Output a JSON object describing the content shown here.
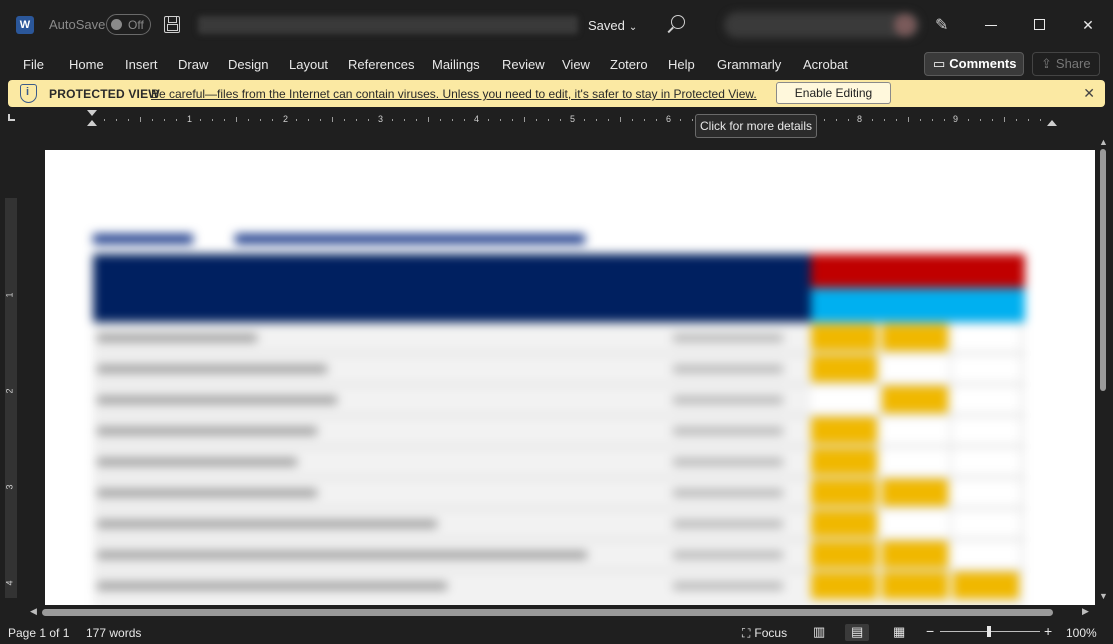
{
  "titlebar": {
    "app_icon": "word-icon",
    "app_letter": "W",
    "autosave_label": "AutoSave",
    "autosave_state": "Off",
    "saved_status": "Saved",
    "minimize": "minimize-icon",
    "maximize": "maximize-icon",
    "close": "✕"
  },
  "menu": {
    "items": [
      "File",
      "Home",
      "Insert",
      "Draw",
      "Design",
      "Layout",
      "References",
      "Mailings",
      "Review",
      "View",
      "Zotero",
      "Help",
      "Grammarly",
      "Acrobat"
    ],
    "comments_label": "Comments",
    "share_label": "Share"
  },
  "protected_view": {
    "title": "PROTECTED VIEW",
    "message": "Be careful—files from the Internet can contain viruses. Unless you need to edit, it's safer to stay in Protected View.",
    "button": "Enable Editing",
    "close": "✕"
  },
  "ruler": {
    "numbers": [
      "1",
      "2",
      "3",
      "4",
      "5",
      "6",
      "7",
      "8",
      "9"
    ],
    "vertical_numbers": [
      "1",
      "2",
      "3",
      "4"
    ]
  },
  "tooltip": {
    "text": "Click for more details"
  },
  "statusbar": {
    "page": "Page 1 of 1",
    "words": "177 words",
    "focus": "Focus",
    "zoom": "100%",
    "zoom_minus": "−",
    "zoom_plus": "+"
  },
  "colors": {
    "banner": "#fbe9a3",
    "table_header": "#002060",
    "table_red": "#c00000",
    "table_cyan": "#00b0f0",
    "cell_yellow": "#f0b800"
  }
}
